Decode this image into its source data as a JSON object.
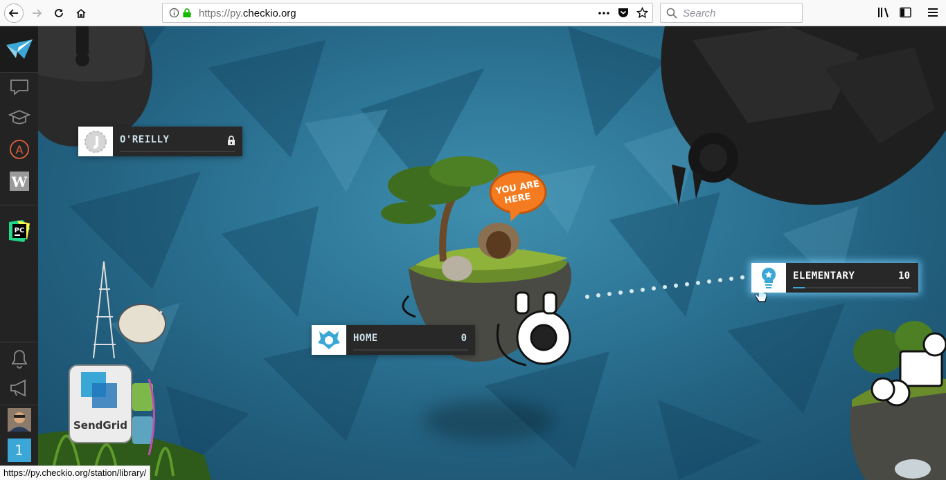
{
  "browser": {
    "url_prefix": "https://py.",
    "url_host": "checkio.org",
    "search_placeholder": "Search",
    "status_link": "https://py.checkio.org/station/library/"
  },
  "sidebar": {
    "items": [
      {
        "name": "checkio-logo"
      },
      {
        "name": "chat-icon"
      },
      {
        "name": "education-icon"
      },
      {
        "name": "achievements-icon",
        "label": "A"
      },
      {
        "name": "w-icon",
        "label": "W"
      },
      {
        "name": "pycharm-icon",
        "label": "PC"
      },
      {
        "name": "bell-icon"
      },
      {
        "name": "megaphone-icon"
      },
      {
        "name": "avatar"
      },
      {
        "name": "level-badge",
        "label": "1"
      }
    ]
  },
  "map": {
    "you_are_here": [
      "YOU ARE",
      "HERE"
    ],
    "sponsor": "SendGrid",
    "stations": [
      {
        "id": "oreilly",
        "label": "O'REILLY",
        "count": "",
        "locked": true,
        "progress": 0
      },
      {
        "id": "home",
        "label": "HOME",
        "count": "0",
        "locked": false,
        "progress": 0
      },
      {
        "id": "elementary",
        "label": "ELEMENTARY",
        "count": "10",
        "locked": false,
        "progress": 0.1
      }
    ]
  },
  "colors": {
    "accent": "#3aa7d6",
    "sidebar": "#232323",
    "badge_bg": "#282828",
    "bubble": "#f47b20"
  }
}
